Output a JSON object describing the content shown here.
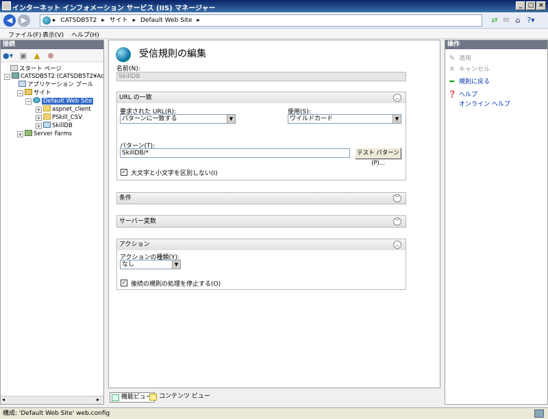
{
  "window": {
    "title": "インターネット インフォメーション サービス (IIS) マネージャー",
    "controls": {
      "minimize": "_",
      "maximize": "□",
      "close": "×"
    }
  },
  "address": {
    "back_icon": "back-arrow-icon",
    "forward_icon": "forward-arrow-icon",
    "crumbs": [
      "CATSDB5T2",
      "サイト",
      "Default Web Site"
    ],
    "separator": "▸"
  },
  "menu": [
    "ファイル(F)",
    "表示(V)",
    "ヘルプ(H)"
  ],
  "connections": {
    "header": "接続",
    "tree": [
      {
        "label": "スタート ページ",
        "icon": "start-page-icon"
      },
      {
        "label": "CATSDB5T2 (CATSDB5T2¥Ac",
        "icon": "server-icon"
      },
      {
        "label": "アプリケーション プール",
        "icon": "app-pool-icon"
      },
      {
        "label": "サイト",
        "icon": "sites-icon"
      },
      {
        "label": "Default Web Site",
        "icon": "globe-icon"
      },
      {
        "label": "aspnet_client",
        "icon": "folder-icon"
      },
      {
        "label": "PSkill_CSV",
        "icon": "folder-icon"
      },
      {
        "label": "SkillDB",
        "icon": "app-icon"
      },
      {
        "label": "Server Farms",
        "icon": "server-farm-icon"
      }
    ]
  },
  "editor": {
    "title": "受信規則の編集",
    "name_label": "名前(N):",
    "name_value": "SkillDB",
    "url_match": {
      "header": "URL の一致",
      "requested_url_label": "要求された URL(R):",
      "requested_url_value": "パターンに一致する",
      "using_label": "使用(S):",
      "using_value": "ワイルドカード",
      "pattern_label": "パターン(T):",
      "pattern_value": "SkillDB/*",
      "test_button": "テスト パターン(P)...",
      "ignore_case_label": "大文字と小文字を区別しない(I)",
      "ignore_case_checked": true
    },
    "conditions": {
      "header": "条件"
    },
    "server_variables": {
      "header": "サーバー変数"
    },
    "action": {
      "header": "アクション",
      "type_label": "アクションの種類(Y):",
      "type_value": "なし",
      "stop_label": "後続の規則の処理を停止する(O)",
      "stop_checked": true
    }
  },
  "bottom_tabs": [
    "機能ビュー",
    "コンテンツ ビュー"
  ],
  "actions": {
    "header": "操作",
    "items": [
      {
        "label": "適用",
        "icon": "apply-icon",
        "enabled": false
      },
      {
        "label": "キャンセル",
        "icon": "cancel-icon",
        "enabled": false
      },
      {
        "label": "規則に戻る",
        "icon": "back-green-arrow-icon",
        "enabled": true
      },
      {
        "label": "ヘルプ",
        "icon": "help-icon",
        "enabled": true
      },
      {
        "label": "オンライン ヘルプ",
        "icon": "",
        "enabled": true
      }
    ]
  },
  "status": {
    "text": "構成: 'Default Web Site' web.config"
  },
  "colors": {
    "selection": "#3169c6",
    "link": "#0033aa",
    "header": "#6e7687"
  }
}
